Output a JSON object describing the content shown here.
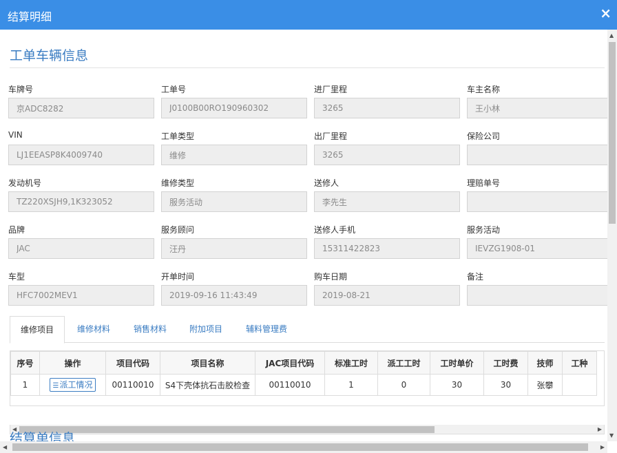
{
  "dialog": {
    "title": "结算明细",
    "close": "×"
  },
  "section1": {
    "title": "工单车辆信息"
  },
  "section2": {
    "title": "结算单信息"
  },
  "fields": [
    {
      "label": "车牌号",
      "value": "京ADC8282"
    },
    {
      "label": "工单号",
      "value": "J0100B00RO190960302"
    },
    {
      "label": "进厂里程",
      "value": "3265"
    },
    {
      "label": "车主名称",
      "value": "王小林"
    },
    {
      "label": "VIN",
      "value": "LJ1EEASP8K4009740"
    },
    {
      "label": "工单类型",
      "value": "维修"
    },
    {
      "label": "出厂里程",
      "value": "3265"
    },
    {
      "label": "保险公司",
      "value": ""
    },
    {
      "label": "发动机号",
      "value": "TZ220XSJH9,1K323052"
    },
    {
      "label": "维修类型",
      "value": "服务活动"
    },
    {
      "label": "送修人",
      "value": "李先生"
    },
    {
      "label": "理赔单号",
      "value": ""
    },
    {
      "label": "品牌",
      "value": "JAC"
    },
    {
      "label": "服务顾问",
      "value": "汪丹"
    },
    {
      "label": "送修人手机",
      "value": "15311422823"
    },
    {
      "label": "服务活动",
      "value": "IEVZG1908-01"
    },
    {
      "label": "车型",
      "value": "HFC7002MEV1"
    },
    {
      "label": "开单时间",
      "value": "2019-09-16 11:43:49"
    },
    {
      "label": "购车日期",
      "value": "2019-08-21"
    },
    {
      "label": "备注",
      "value": ""
    }
  ],
  "tabs": [
    "维修项目",
    "维修材料",
    "销售材料",
    "附加项目",
    "辅料管理费"
  ],
  "grid": {
    "headers": [
      "序号",
      "操作",
      "项目代码",
      "项目名称",
      "JAC项目代码",
      "标准工时",
      "派工工时",
      "工时单价",
      "工时费",
      "技师",
      "工种"
    ],
    "row": {
      "index": "1",
      "action_icon": "list-icon",
      "action_label": "派工情况",
      "code": "00110010",
      "name": "S4下壳体抗石击胶检查",
      "jac_code": "00110010",
      "std_hours": "1",
      "dispatch_hours": "0",
      "unit_price": "30",
      "labor_fee": "30",
      "technician": "张攀",
      "work_type": ""
    }
  },
  "icons": {
    "close": "close-icon",
    "scroll_left": "arrow-left-icon",
    "scroll_right": "arrow-right-icon",
    "scroll_up": "arrow-up-icon",
    "scroll_down": "arrow-down-icon"
  },
  "colors": {
    "header": "#3a8ee6",
    "accent": "#3a7cc2",
    "input_bg": "#eeeeee"
  }
}
